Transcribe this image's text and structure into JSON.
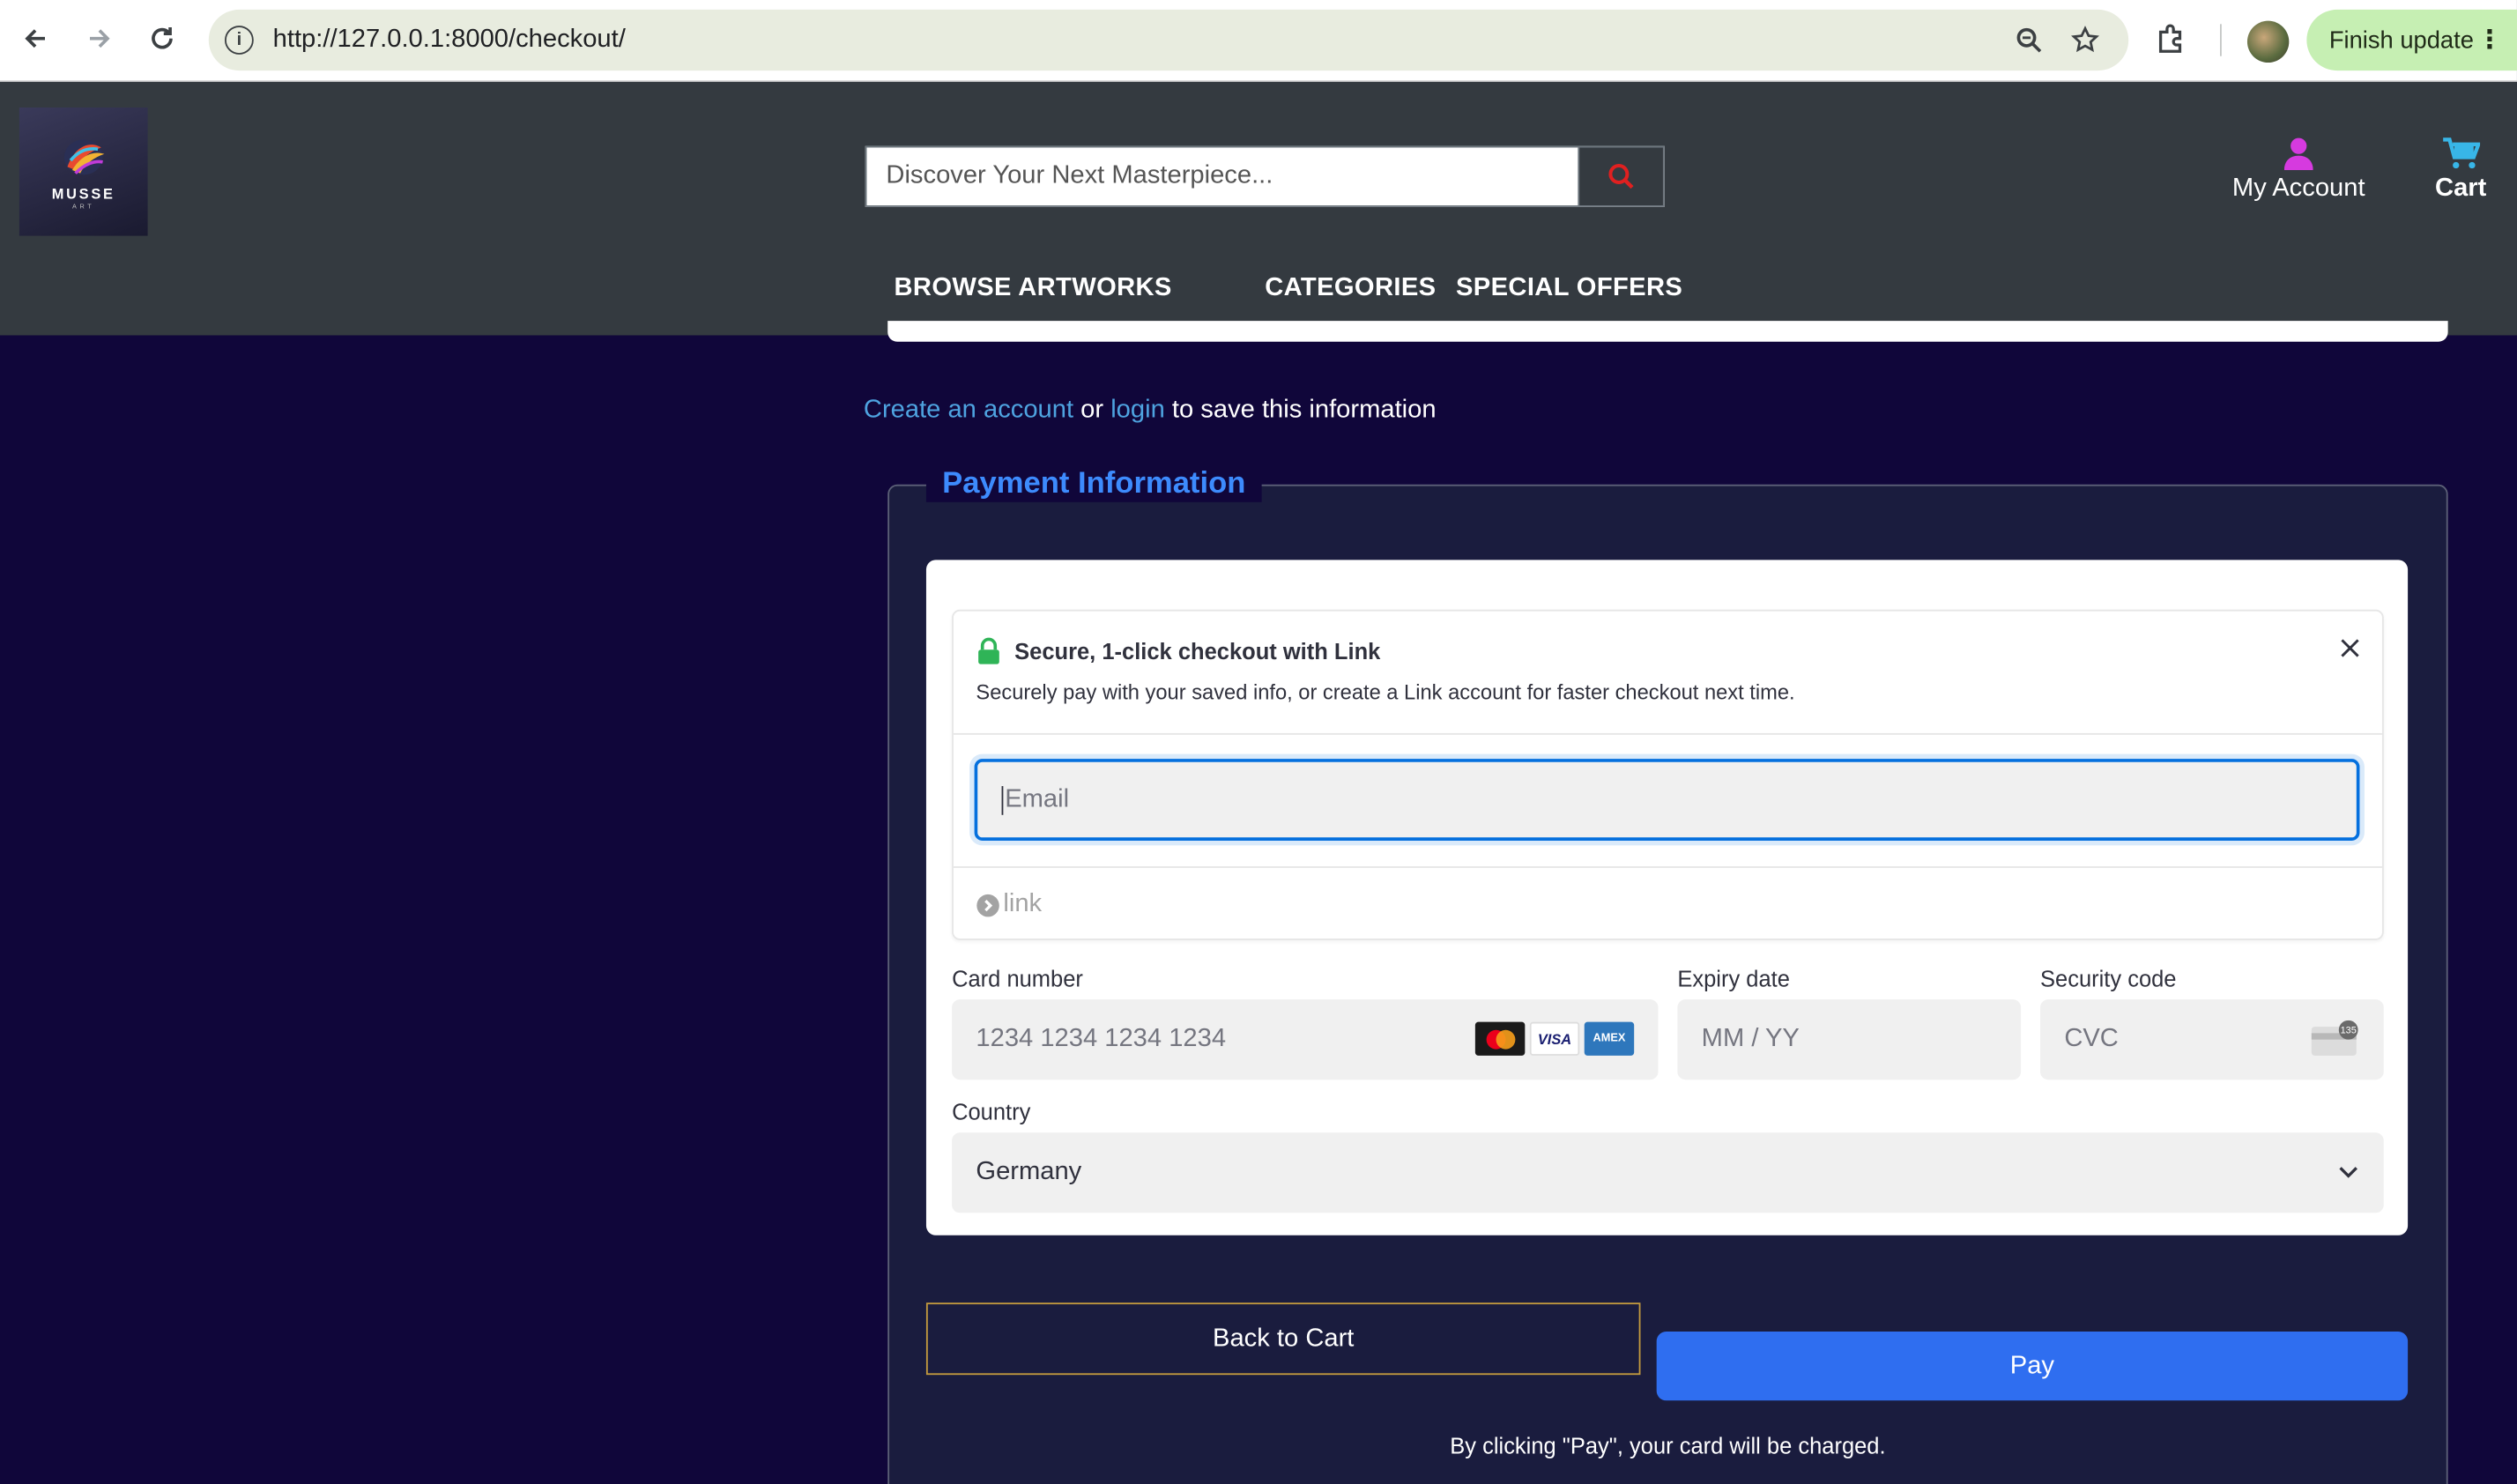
{
  "browser": {
    "url": "http://127.0.0.1:8000/checkout/",
    "finish_update_label": "Finish update"
  },
  "header": {
    "logo_text": "MUSSE",
    "logo_subtext": "ART",
    "search_placeholder": "Discover Your Next Masterpiece...",
    "account_label": "My Account",
    "cart_label": "Cart",
    "nav": [
      {
        "label": "BROWSE ARTWORKS"
      },
      {
        "label": "CATEGORIES"
      },
      {
        "label": "SPECIAL OFFERS"
      }
    ],
    "colors": {
      "account_icon": "#d63adf",
      "cart_icon": "#38b6e8",
      "search_icon": "#e02020"
    }
  },
  "account_prompt": {
    "create_link": "Create an account",
    "or_text": "or",
    "login_link": "login",
    "suffix": "to save this information"
  },
  "payment": {
    "legend": "Payment Information",
    "link": {
      "title": "Secure, 1-click checkout with Link",
      "description": "Securely pay with your saved info, or create a Link account for faster checkout next time.",
      "email_placeholder": "Email",
      "brand": "link"
    },
    "card_number": {
      "label": "Card number",
      "placeholder": "1234 1234 1234 1234",
      "brands": [
        "mastercard-icon",
        "visa-icon",
        "amex-icon"
      ]
    },
    "expiry": {
      "label": "Expiry date",
      "placeholder": "MM / YY"
    },
    "cvc": {
      "label": "Security code",
      "placeholder": "CVC"
    },
    "country": {
      "label": "Country",
      "value": "Germany"
    },
    "back_button": "Back to Cart",
    "pay_button": "Pay",
    "disclaimer": "By clicking \"Pay\", your card will be charged."
  }
}
